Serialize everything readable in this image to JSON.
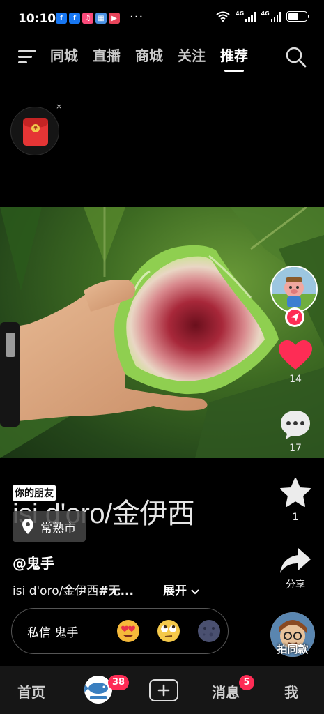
{
  "status_bar": {
    "time": "10:10",
    "notification_icons": [
      "facebook-icon",
      "facebook-icon",
      "music-icon",
      "calendar-icon",
      "video-icon"
    ],
    "more": "···",
    "network_labels": [
      "4G",
      "4G"
    ]
  },
  "top_nav": {
    "tabs": [
      {
        "label": "同城",
        "active": false
      },
      {
        "label": "直播",
        "active": false
      },
      {
        "label": "商城",
        "active": false
      },
      {
        "label": "关注",
        "active": false
      },
      {
        "label": "推荐",
        "active": true
      }
    ]
  },
  "red_packet": {
    "close": "×",
    "coin": "¥"
  },
  "right_rail": {
    "like_count": "14",
    "comment_count": "17",
    "favorite_count": "1",
    "share_label": "分享",
    "same_style_label": "拍同款"
  },
  "info": {
    "friend_tag": "你的朋友",
    "big_title": "isi d'oro/金伊西",
    "location": "常熟市",
    "author": "@鬼手",
    "caption": "isi d'oro/金伊西",
    "caption_tag": "#无...",
    "expand": "展开"
  },
  "dm_bar": {
    "label": "私信 鬼手"
  },
  "bottom_nav": {
    "home": "首页",
    "avatar_badge": "38",
    "messages": "消息",
    "messages_badge": "5",
    "me": "我"
  },
  "colors": {
    "accent": "#fe2c55",
    "background": "#000000",
    "like": "#fe2c55"
  }
}
